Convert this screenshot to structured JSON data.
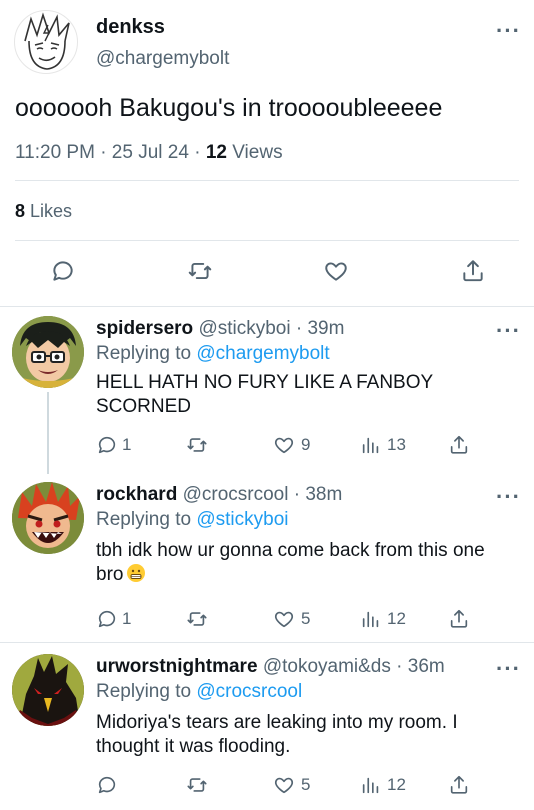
{
  "main_tweet": {
    "display_name": "denkss",
    "handle": "@chargemybolt",
    "text": "ooooooh Bakugou's in troooouble​eeee",
    "time": "11:20 PM · 25 Jul 24 · ",
    "views_count": "12",
    "views_label": " Views",
    "likes_count": "8",
    "likes_label": " Likes"
  },
  "replies": [
    {
      "display_name": "spidersero",
      "handle": "@stickyboi",
      "age": " · 39m",
      "replying_prefix": "Replying to ",
      "replying_to": "@chargemybolt",
      "text": "HELL HATH NO FURY LIKE A FANBOY SCORNED",
      "reply_count": "1",
      "retweet_count": "",
      "like_count": "9",
      "view_count": "13"
    },
    {
      "display_name": "rockhard",
      "handle": "@crocsrcool",
      "age": " · 38m",
      "replying_prefix": "Replying to ",
      "replying_to": "@stickyboi",
      "text": "tbh idk how ur gonna come back from this one bro",
      "reply_count": "1",
      "retweet_count": "",
      "like_count": "5",
      "view_count": "12"
    },
    {
      "display_name": "urworstnightmare",
      "handle": "@tokoyami&ds",
      "age": " · 36m",
      "replying_prefix": "Replying to ",
      "replying_to": "@crocsrcool",
      "text": "Midoriya's tears are leaking into my room. I thought it was flooding.",
      "reply_count": "",
      "retweet_count": "",
      "like_count": "5",
      "view_count": "12"
    }
  ],
  "colors": {
    "link": "#1d9bf0",
    "secondary_text": "#536471",
    "primary_text": "#0f1419",
    "divider": "#e1e6ea"
  },
  "icons": [
    "reply-icon",
    "retweet-icon",
    "like-icon",
    "views-icon",
    "share-icon",
    "more-icon"
  ]
}
